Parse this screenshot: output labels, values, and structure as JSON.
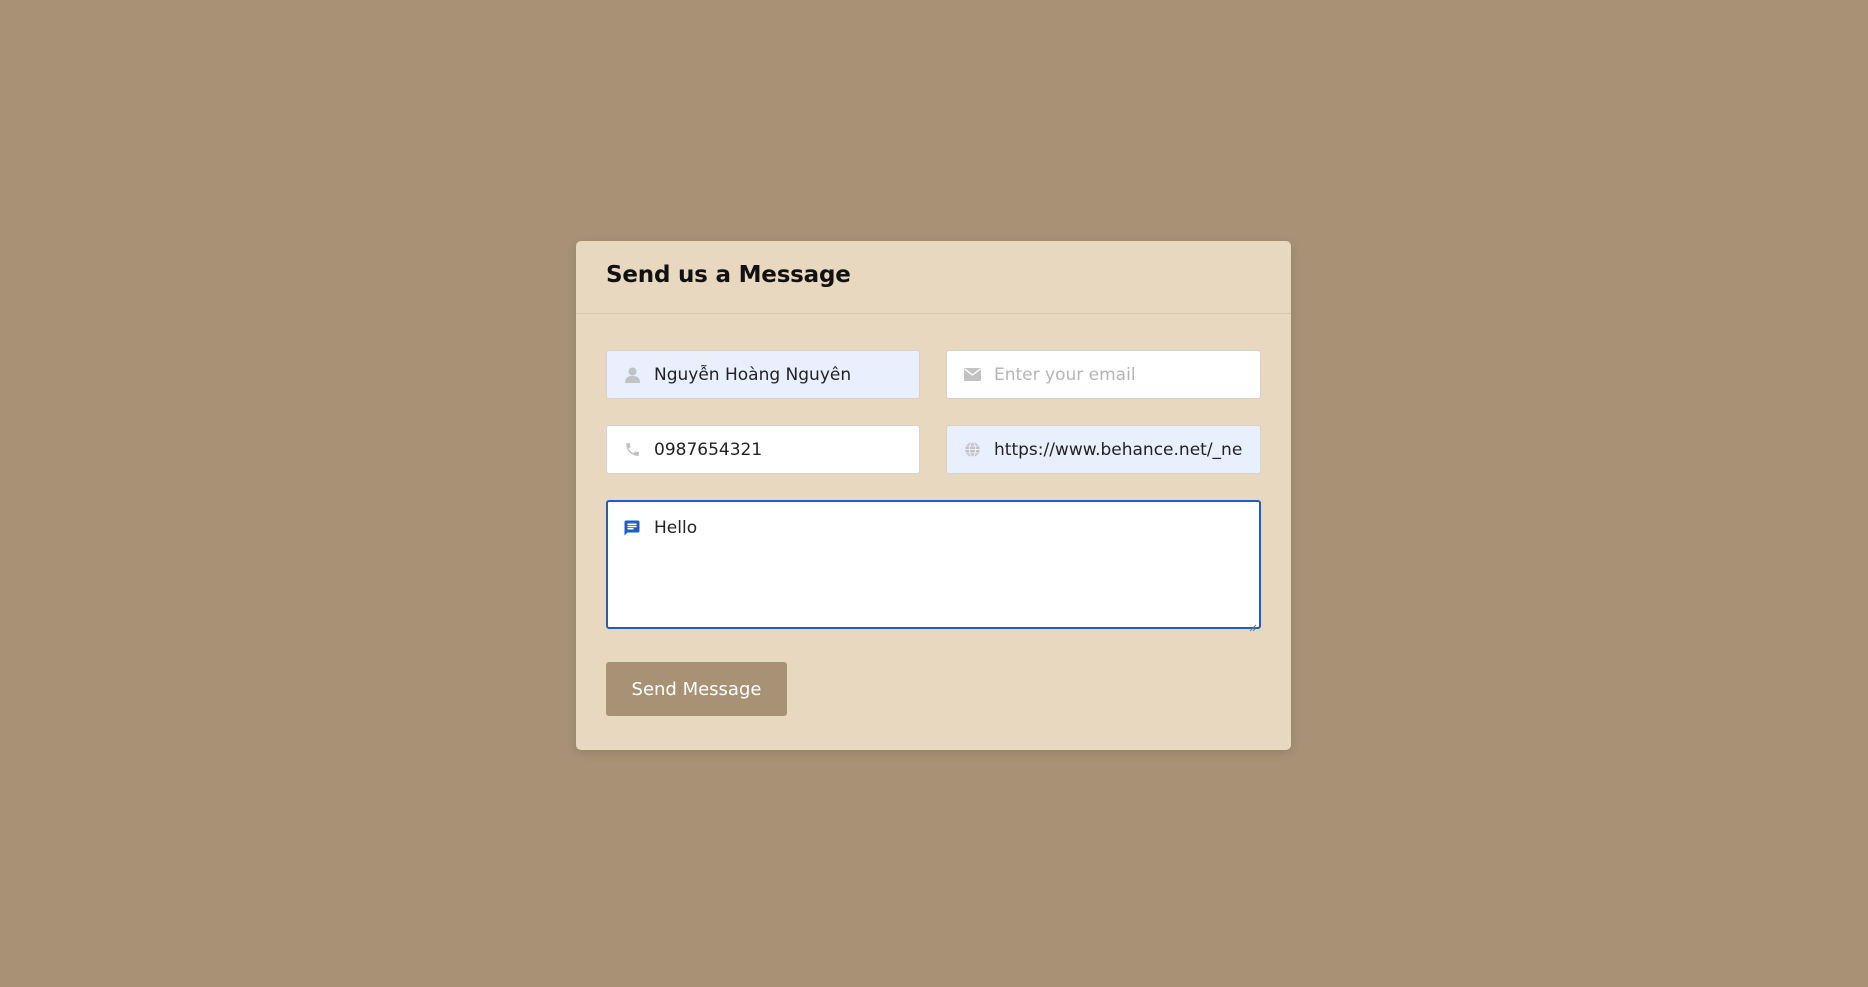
{
  "form": {
    "title": "Send us a Message",
    "fields": {
      "name": {
        "value": "Nguyễn Hoàng Nguyên",
        "icon": "user-icon"
      },
      "email": {
        "placeholder": "Enter your email",
        "value": "",
        "icon": "envelope-icon"
      },
      "phone": {
        "value": "0987654321",
        "icon": "phone-icon"
      },
      "website": {
        "value": "https://www.behance.net/_neyt",
        "icon": "globe-icon"
      },
      "message": {
        "value": "Hello",
        "icon": "message-icon"
      }
    },
    "submit_label": "Send Message"
  },
  "colors": {
    "page_background": "#a89276",
    "card_background": "#e8d8c0",
    "button_background": "#a89276",
    "focus_border": "#1a5fc2",
    "autofill_background": "#e8f0fe"
  }
}
